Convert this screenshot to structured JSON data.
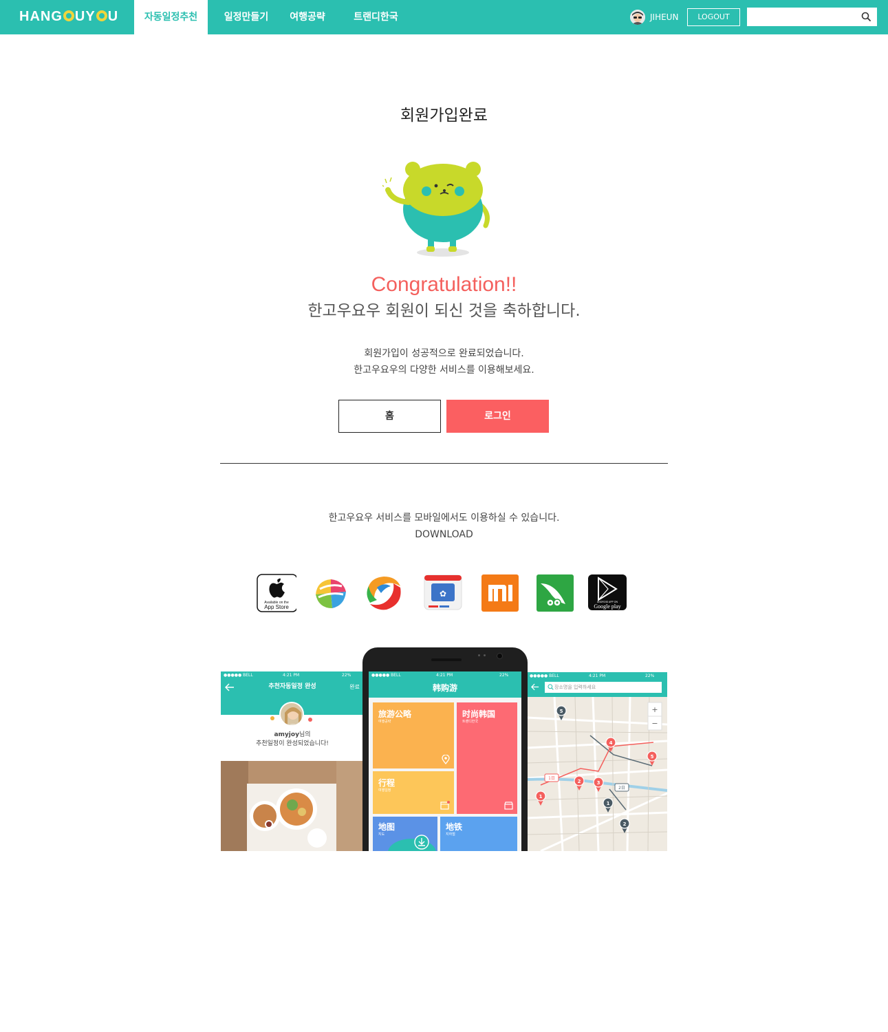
{
  "header": {
    "logo_text": "HANGOUYOU",
    "tabs": [
      {
        "label": "자동일정추천",
        "active": true
      },
      {
        "label": "일정만들기",
        "active": false
      },
      {
        "label": "여행공략",
        "active": false
      },
      {
        "label": "트랜디한국",
        "active": false
      }
    ],
    "user_name": "JIHEUN",
    "logout_label": "LOGOUT",
    "search_placeholder": ""
  },
  "main": {
    "title": "회원가입완료",
    "congrats": "Congratulation!!",
    "congrats_sub": "한고우요우 회원이 되신 것을 축하합니다.",
    "desc_lines": [
      "회원가입이 성공적으로 완료되었습니다.",
      "한고우요우의 다양한 서비스를 이용해보세요."
    ],
    "home_button": "홈",
    "login_button": "로그인"
  },
  "download": {
    "mobile_text": "한고우요우 서비스를 모바일에서도 이용하실 수 있습니다.",
    "download_label": "DOWNLOAD",
    "stores": [
      {
        "icon": "app-store-icon",
        "label_top": "Available on the",
        "label": "App Store"
      },
      {
        "icon": "store-colorful-icon"
      },
      {
        "icon": "store-swirl-icon"
      },
      {
        "icon": "baidu-store-icon"
      },
      {
        "icon": "xiaomi-icon",
        "label": "mi"
      },
      {
        "icon": "wandoujia-icon"
      },
      {
        "icon": "google-play-icon",
        "label_top": "ANDROID APP ON",
        "label": "Google play"
      }
    ]
  },
  "phones": {
    "left": {
      "status_carrier": "●●●●● BELL",
      "status_time": "4:21 PM",
      "status_battery": "22%",
      "title": "추천자동일정 완성",
      "done_label": "완료",
      "user_name": "amyjoy",
      "user_suffix": "님의",
      "message": "추천일정이 완성되었습니다!"
    },
    "center": {
      "status_carrier": "●●●●● BELL",
      "status_time": "4:21 PM",
      "status_battery": "22%",
      "app_title": "韩购游",
      "tiles": [
        {
          "title": "旅游公略",
          "subtitle": "여행공략",
          "color": "#fbb24f"
        },
        {
          "title": "时尚韩国",
          "subtitle": "트랜디한국",
          "color": "#fd6a73"
        },
        {
          "title": "行程",
          "subtitle": "여행일정",
          "color": "#fdc659"
        },
        {
          "title": "地图",
          "subtitle": "지도",
          "color": "#5b92e6"
        },
        {
          "title": "地铁",
          "subtitle": "지하철",
          "color": "#5ba2ef"
        }
      ]
    },
    "right": {
      "status_carrier": "●●●●● BELL",
      "status_time": "4:21 PM",
      "status_battery": "22%",
      "search_placeholder": "장소명을 입력하세요",
      "zoom_in": "+",
      "zoom_out": "−",
      "markers": [
        {
          "label": "5",
          "color": "#4a5a64"
        },
        {
          "label": "4",
          "color": "#f4605d"
        },
        {
          "label": "5",
          "color": "#f4605d"
        },
        {
          "label": "2",
          "color": "#f4605d"
        },
        {
          "label": "3",
          "color": "#f4605d"
        },
        {
          "label": "1",
          "color": "#f4605d"
        },
        {
          "label": "1",
          "color": "#4a5a64"
        },
        {
          "label": "2",
          "color": "#4a5a64"
        }
      ],
      "day1_tag": "1日",
      "day2_tag": "2日"
    }
  },
  "colors": {
    "brand": "#2bbfb0",
    "accent": "#f4605d",
    "logo_o": "#f0d53c"
  }
}
